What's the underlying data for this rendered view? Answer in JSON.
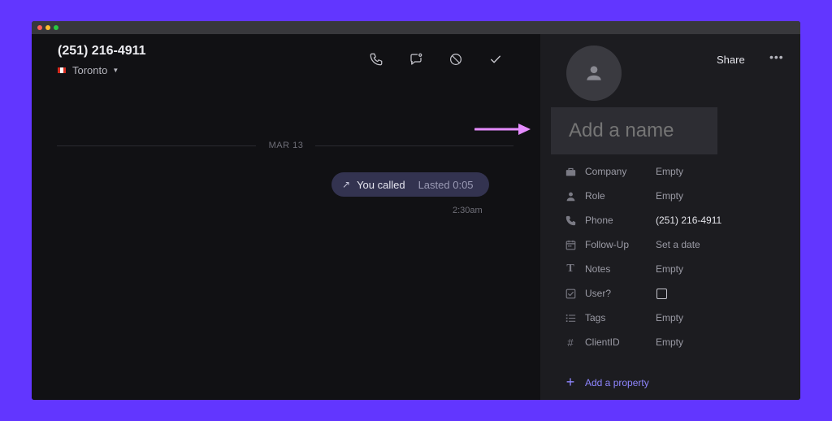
{
  "window": {
    "controls": [
      "close",
      "minimize",
      "zoom"
    ]
  },
  "conversation": {
    "phone_number": "(251) 216-4911",
    "location": "Toronto",
    "location_flag": "canada-flag-icon",
    "toolbar": [
      {
        "name": "call-button",
        "icon": "phone-icon"
      },
      {
        "name": "message-button",
        "icon": "chat-bubble-icon"
      },
      {
        "name": "block-button",
        "icon": "block-icon"
      },
      {
        "name": "mark-done-button",
        "icon": "checkmark-icon"
      }
    ],
    "date_divider": "MAR 13",
    "call": {
      "direction_icon": "outgoing-arrow-icon",
      "label": "You called",
      "duration": "Lasted 0:05",
      "time": "2:30am"
    }
  },
  "contact": {
    "share_label": "Share",
    "more_label": "•••",
    "name_placeholder": "Add a name",
    "properties": [
      {
        "label": "Company",
        "value": "Empty",
        "icon": "briefcase-icon"
      },
      {
        "label": "Role",
        "value": "Empty",
        "icon": "person-icon"
      },
      {
        "label": "Phone",
        "value": "(251) 216-4911",
        "icon": "phone-icon"
      },
      {
        "label": "Follow-Up",
        "value": "Set a date",
        "icon": "calendar-icon"
      },
      {
        "label": "Notes",
        "value": "Empty",
        "icon": "text-icon"
      },
      {
        "label": "User?",
        "value": "",
        "icon": "checkbox-icon"
      },
      {
        "label": "Tags",
        "value": "Empty",
        "icon": "list-icon"
      },
      {
        "label": "ClientID",
        "value": "Empty",
        "icon": "hash-icon"
      }
    ],
    "add_property_label": "Add a property"
  },
  "colors": {
    "background": "#6236ff",
    "window": "#111114",
    "panel": "#1c1c20",
    "accent": "#8f86ff",
    "annotation_arrow": "#e58cff"
  }
}
